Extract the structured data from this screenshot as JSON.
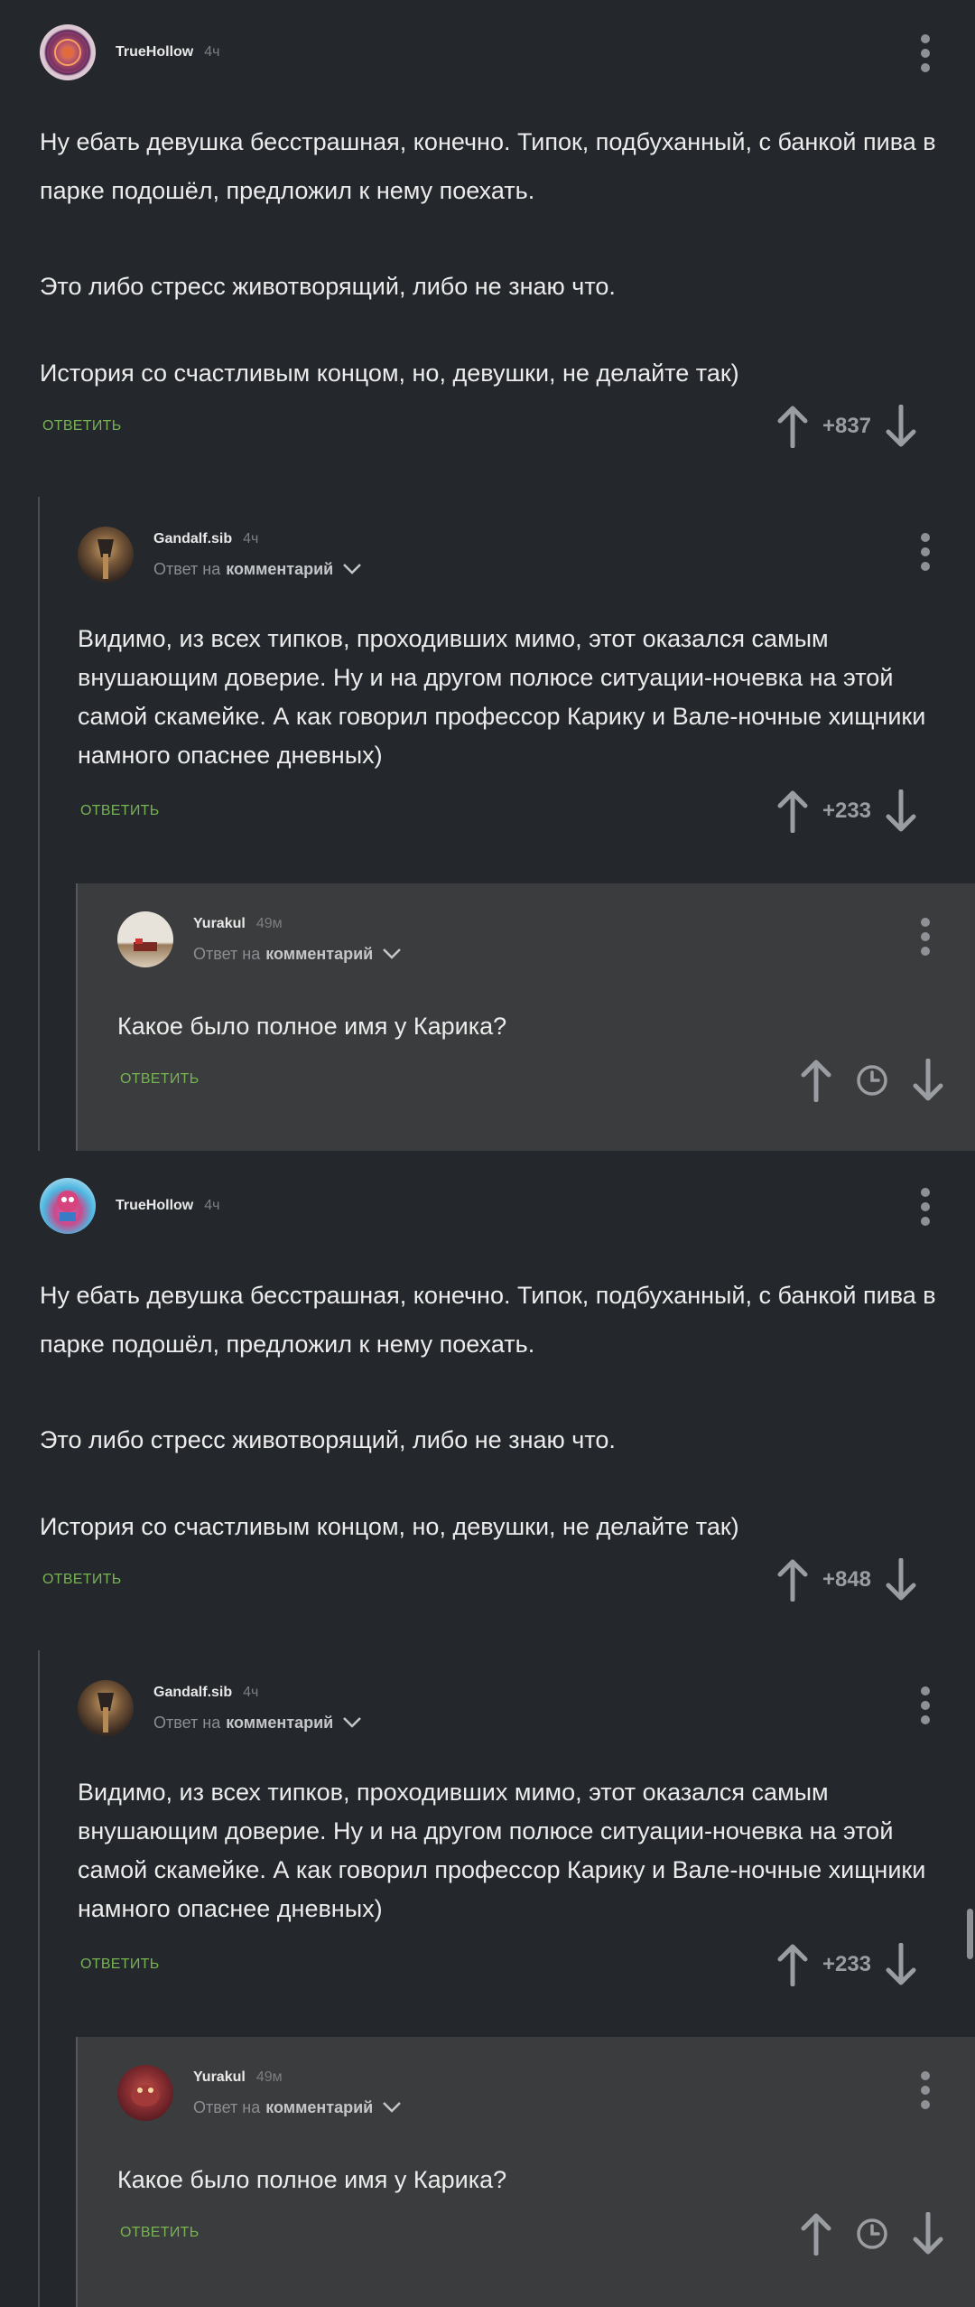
{
  "threads": [
    {
      "main": {
        "author": "TrueHollow",
        "time": "4ч",
        "paragraphs": [
          "Ну ебать девушка бесстрашная, конечно. Типок, подбуханный, с банкой пива в парке подошёл, предложил к нему поехать.",
          "Это либо стресс животворящий, либо не знаю что.",
          "История со счастливым концом, но, девушки, не делайте так)"
        ],
        "reply_label": "ОТВЕТИТЬ",
        "score": "+837"
      },
      "reply": {
        "author": "Gandalf.sib",
        "time": "4ч",
        "reply_to_prefix": "Ответ на",
        "reply_to_target": "комментарий",
        "text": "Видимо, из всех типков, проходивших мимо, этот оказался самым внушающим доверие. Ну и на другом полюсе ситуации-ночевка на этой самой скамейке. А как говорил профессор Карику и Вале-ночные хищники намного опаснее дневных)",
        "reply_label": "ОТВЕТИТЬ",
        "score": "+233"
      },
      "nested": {
        "author": "Yurakul",
        "time": "49м",
        "reply_to_prefix": "Ответ на",
        "reply_to_target": "комментарий",
        "text": "Какое было полное имя у Карика?",
        "reply_label": "ОТВЕТИТЬ"
      }
    },
    {
      "main": {
        "author": "TrueHollow",
        "time": "4ч",
        "paragraphs": [
          "Ну ебать девушка бесстрашная, конечно. Типок, подбуханный, с банкой пива в парке подошёл, предложил к нему поехать.",
          "Это либо стресс животворящий, либо не знаю что.",
          "История со счастливым концом, но, девушки, не делайте так)"
        ],
        "reply_label": "ОТВЕТИТЬ",
        "score": "+848"
      },
      "reply": {
        "author": "Gandalf.sib",
        "time": "4ч",
        "reply_to_prefix": "Ответ на",
        "reply_to_target": "комментарий",
        "text": "Видимо, из всех типков, проходивших мимо, этот оказался самым внушающим доверие. Ну и на другом полюсе ситуации-ночевка на этой самой скамейке. А как говорил профессор Карику и Вале-ночные хищники намного опаснее дневных)",
        "reply_label": "ОТВЕТИТЬ",
        "score": "+233"
      },
      "nested": {
        "author": "Yurakul",
        "time": "49м",
        "reply_to_prefix": "Ответ на",
        "reply_to_target": "комментарий",
        "text": "Какое было полное имя у Карика?",
        "reply_label": "ОТВЕТИТЬ"
      }
    }
  ],
  "icons": {
    "more": "more-vertical-icon",
    "upvote": "arrow-up-icon",
    "downvote": "arrow-down-icon",
    "pending": "clock-icon",
    "dropdown": "chevron-down-icon"
  },
  "colors": {
    "background": "#24272b",
    "nested_background": "#3b3c3d",
    "reply_button": "#77b255",
    "score": "#9a9da1"
  }
}
